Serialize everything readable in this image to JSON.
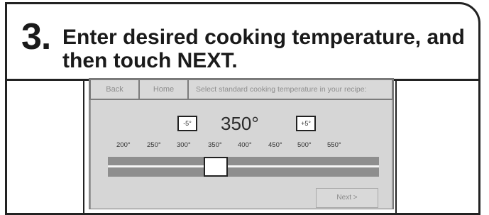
{
  "step": {
    "number": "3.",
    "instruction": "Enter desired cooking temperature, and then touch NEXT."
  },
  "screen": {
    "nav": {
      "back_label": "Back",
      "home_label": "Home",
      "prompt": "Select standard cooking temperature in your recipe:"
    },
    "temperature": {
      "decrement_label": "-5°",
      "current_value": "350°",
      "increment_label": "+5°"
    },
    "slider": {
      "ticks": [
        "200°",
        "250°",
        "300°",
        "350°",
        "400°",
        "450°",
        "500°",
        "550°"
      ],
      "selected_value": "350°"
    },
    "next_label": "Next >"
  }
}
